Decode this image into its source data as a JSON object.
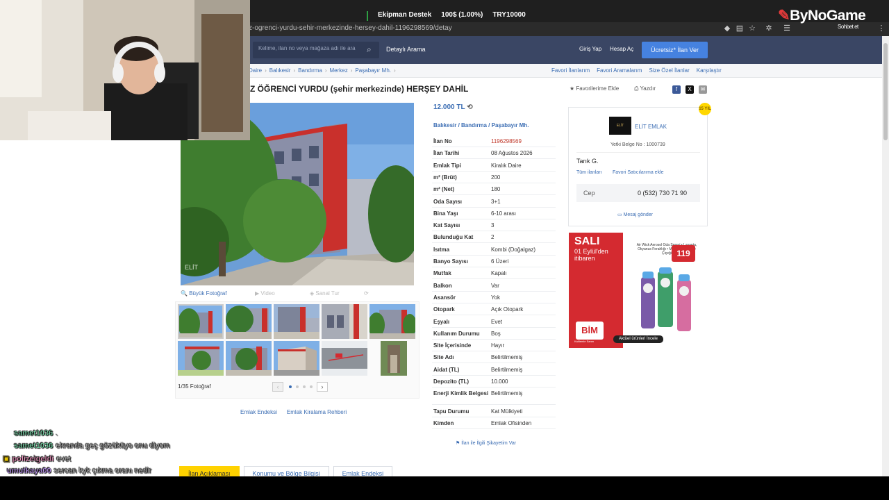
{
  "browser": {
    "url": "z-ogrenci-yurdu-sehir-merkezinde-hersey-dahil-1196298569/detay",
    "ticker": {
      "label": "Ekipman Destek",
      "progress": "100$ (1.00%)",
      "currency": "TRY10000"
    }
  },
  "stream": {
    "logo": "ByNoGame",
    "logo_sub": "Sohbet et"
  },
  "header": {
    "search_placeholder": "Kelime, ilan no veya mağaza adı ile ara",
    "advanced_search": "Detaylı Arama",
    "login": "Giriş Yap",
    "register": "Hesap Aç",
    "post_ad": "Ücretsiz* İlan Ver"
  },
  "breadcrumb": [
    "Daire",
    "Balıkesir",
    "Bandırma",
    "Merkez",
    "Paşabayır Mh."
  ],
  "top_links": [
    "Favori İlanlarım",
    "Favori Aramalarım",
    "Size Özel İlanlar",
    "Karşılaştır"
  ],
  "listing": {
    "title": "Z ÖĞRENCİ YURDU (şehir merkezinde) HERŞEY DAHİL",
    "add_favorite": "Favorilerime Ekle",
    "print": "Yazdır",
    "price": "12.000 TL",
    "location": [
      "Balıkesir",
      "Bandırma",
      "Paşabayır Mh."
    ],
    "watermark": "ELİT"
  },
  "details": [
    {
      "key": "İlan No",
      "value": "1196298569"
    },
    {
      "key": "İlan Tarihi",
      "value": "08 Ağustos 2026"
    },
    {
      "key": "Emlak Tipi",
      "value": "Kiralık Daire"
    },
    {
      "key": "m² (Brüt)",
      "value": "200"
    },
    {
      "key": "m² (Net)",
      "value": "180"
    },
    {
      "key": "Oda Sayısı",
      "value": "3+1"
    },
    {
      "key": "Bina Yaşı",
      "value": "6-10 arası"
    },
    {
      "key": "Kat Sayısı",
      "value": "3"
    },
    {
      "key": "Bulunduğu Kat",
      "value": "2"
    },
    {
      "key": "Isıtma",
      "value": "Kombi (Doğalgaz)"
    },
    {
      "key": "Banyo Sayısı",
      "value": "6 Üzeri"
    },
    {
      "key": "Mutfak",
      "value": "Kapalı"
    },
    {
      "key": "Balkon",
      "value": "Var"
    },
    {
      "key": "Asansör",
      "value": "Yok"
    },
    {
      "key": "Otopark",
      "value": "Açık Otopark"
    },
    {
      "key": "Eşyalı",
      "value": "Evet"
    },
    {
      "key": "Kullanım Durumu",
      "value": "Boş"
    },
    {
      "key": "Site İçerisinde",
      "value": "Hayır"
    },
    {
      "key": "Site Adı",
      "value": "Belirtilmemiş"
    },
    {
      "key": "Aidat (TL)",
      "value": "Belirtilmemiş"
    },
    {
      "key": "Depozito (TL)",
      "value": "10.000"
    },
    {
      "key": "Enerji Kimlik Belgesi",
      "value": "Belirtilmemiş"
    },
    {
      "key": "Tapu Durumu",
      "value": "Kat Mülkiyeti"
    },
    {
      "key": "Kimden",
      "value": "Emlak Ofisinden"
    }
  ],
  "complaint": "İlan ile İlgili Şikayetim Var",
  "gallery": {
    "big_photo": "Büyük Fotoğraf",
    "video": "Video",
    "tour": "Sanal Tur",
    "photo_count": "1/35 Fotoğraf"
  },
  "bottom_links": [
    "Emlak Endeksi",
    "Emlak Kiralama Rehberi"
  ],
  "tabs": [
    "İlan Açıklaması",
    "Konumu ve Bölge Bilgisi",
    "Emlak Endeksi"
  ],
  "seller": {
    "agency": "ELİT EMLAK",
    "logo_text": "ELİT",
    "license": "Yetki Belge No : 1000739",
    "agent": "Tarık G.",
    "all_ads": "Tüm ilanları",
    "fav_seller": "Favori Satıcılarıma ekle",
    "phone_label": "Cep",
    "phone": "0 (532) 730 71 90",
    "send_message": "Mesaj gönder",
    "badge": "15 YIL"
  },
  "ad": {
    "day": "SALI",
    "date": "01 Eylül'den itibaren",
    "product": "Air Wick Aerosol Oda Spreyi • Lavanta, Okyanus Ferahlığı • Manolya ve Kiraz Çiçeği",
    "price": "119",
    "brand": "BİM",
    "tagline": "Kalitemle Sanm",
    "cta": "Aktüel ürünleri İncele"
  },
  "chat": [
    {
      "user": "samet1036",
      "msg": "."
    },
    {
      "user": "samet1036",
      "msg": "ekranda geç gözüküyo onu diyom"
    },
    {
      "user": "polizeigeldi",
      "msg": "evet"
    },
    {
      "user": "umutkaya00",
      "msg": "sercan kyk çıkma oranı nedir"
    }
  ],
  "colors": {
    "header": "#3a4664",
    "link": "#3b6db3",
    "cta": "#4682e0",
    "ad_red": "#d42a30"
  }
}
